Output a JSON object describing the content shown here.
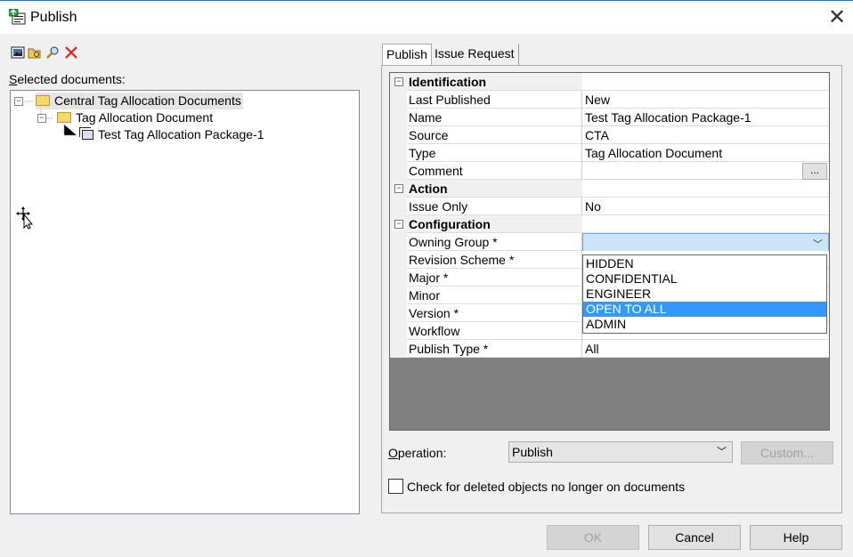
{
  "window": {
    "title": "Publish",
    "close_glyph": "✕"
  },
  "toolbar": {
    "icons": [
      "image-icon",
      "open-folder-icon",
      "find-icon",
      "delete-icon"
    ]
  },
  "left": {
    "selected_label": "Selected documents:",
    "tree": [
      {
        "label": "Central Tag Allocation Documents",
        "type": "folder"
      },
      {
        "label": "Tag Allocation Document",
        "type": "folder"
      },
      {
        "label": "Test Tag Allocation Package-1",
        "type": "package"
      }
    ]
  },
  "tabs": [
    {
      "label": "Publish"
    },
    {
      "label": "Issue Request"
    }
  ],
  "properties": {
    "categories": {
      "identification": "Identification",
      "action": "Action",
      "configuration": "Configuration"
    },
    "rows": {
      "last_published": {
        "name": "Last Published",
        "value": "New"
      },
      "name": {
        "name": "Name",
        "value": "Test Tag Allocation Package-1"
      },
      "source": {
        "name": "Source",
        "value": "CTA"
      },
      "type": {
        "name": "Type",
        "value": "Tag Allocation Document"
      },
      "comment": {
        "name": "Comment",
        "value": "",
        "button": "..."
      },
      "issue_only": {
        "name": "Issue Only",
        "value": "No"
      },
      "owning_group": {
        "name": "Owning Group *",
        "value": ""
      },
      "revision_scheme": {
        "name": "Revision Scheme *",
        "value": ""
      },
      "major": {
        "name": "Major *",
        "value": ""
      },
      "minor": {
        "name": "Minor",
        "value": ""
      },
      "version": {
        "name": "Version *",
        "value": ""
      },
      "workflow": {
        "name": "Workflow",
        "value": ""
      },
      "publish_type": {
        "name": "Publish Type *",
        "value": "All"
      }
    },
    "collapse_glyph": "⊟"
  },
  "owning_group_dropdown": {
    "options": [
      "HIDDEN",
      "CONFIDENTIAL",
      "ENGINEER",
      "OPEN TO ALL",
      "ADMIN"
    ],
    "highlighted": "OPEN TO ALL"
  },
  "operation": {
    "label_prefix": "O",
    "label_rest": "peration:",
    "value": "Publish"
  },
  "custom_button": "Custom...",
  "checkbox_label": "Check for deleted objects no longer on documents",
  "buttons": {
    "ok": "OK",
    "cancel": "Cancel",
    "help": "Help"
  },
  "colors": {
    "selection": "#3399ff",
    "combo_highlight": "#cde3f7",
    "grid_bg": "#808080"
  }
}
